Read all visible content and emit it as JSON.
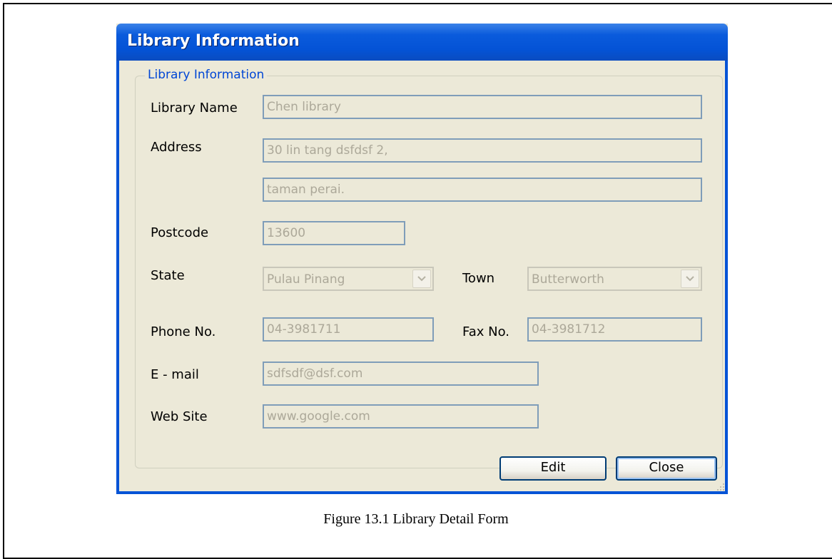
{
  "window": {
    "title": "Library Information"
  },
  "group": {
    "legend": "Library Information"
  },
  "form": {
    "library_name": {
      "label": "Library Name",
      "value": "Chen library"
    },
    "address": {
      "label": "Address",
      "line1": "30 lin tang dsfdsf 2,",
      "line2": "taman perai."
    },
    "postcode": {
      "label": "Postcode",
      "value": "13600"
    },
    "state": {
      "label": "State",
      "value": "Pulau Pinang"
    },
    "town": {
      "label": "Town",
      "value": "Butterworth"
    },
    "phone": {
      "label": "Phone No.",
      "value": "04-3981711"
    },
    "fax": {
      "label": "Fax No.",
      "value": "04-3981712"
    },
    "email": {
      "label": "E - mail",
      "value": "sdfsdf@dsf.com"
    },
    "website": {
      "label": "Web Site",
      "value": "www.google.com"
    }
  },
  "buttons": {
    "edit": "Edit",
    "close": "Close"
  },
  "caption": "Figure 13.1 Library Detail Form",
  "colors": {
    "titlebar": "#0453d6",
    "legend": "#0046d5",
    "disabled_text": "#aca899",
    "field_border": "#7f9db9",
    "window_bg": "#ece9d8"
  },
  "icons": {
    "dropdown": "chevron-down-icon",
    "resize": "resize-grip-icon"
  }
}
